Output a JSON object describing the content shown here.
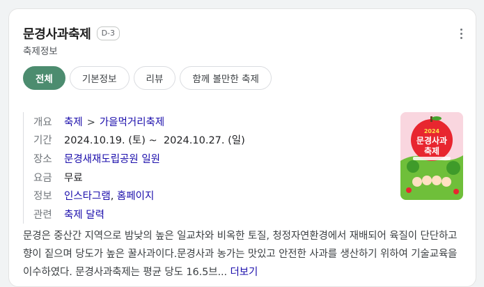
{
  "header": {
    "title": "문경사과축제",
    "dday_badge": "D-3",
    "subtitle": "축제정보"
  },
  "tabs": [
    {
      "label": "전체",
      "active": true
    },
    {
      "label": "기본정보",
      "active": false
    },
    {
      "label": "리뷰",
      "active": false
    },
    {
      "label": "함께 볼만한 축제",
      "active": false
    }
  ],
  "info": {
    "overview": {
      "key": "개요",
      "category": "축제",
      "separator": ">",
      "subcategory": "가을먹거리축제"
    },
    "period": {
      "key": "기간",
      "value": "2024.10.19. (토) ~  2024.10.27. (일)"
    },
    "place": {
      "key": "장소",
      "value": "문경새재도립공원 일원"
    },
    "fee": {
      "key": "요금",
      "value": "무료"
    },
    "links": {
      "key": "정보",
      "instagram": "인스타그램",
      "comma": ",",
      "homepage": "홈페이지"
    },
    "related": {
      "key": "관련",
      "value": "축제 달력"
    }
  },
  "poster": {
    "year": "2024",
    "title_line1": "문경사과",
    "title_line2": "축제",
    "icon": "apple-festival-poster"
  },
  "description": {
    "text": "문경은 중산간 지역으로 밤낮의 높은 일교차와 비옥한 토질, 청정자연환경에서 재배되어 육질이 단단하고 향이 짙으며 당도가 높은 꿀사과이다.문경사과 농가는 맛있고 안전한 사과를 생산하기 위하여 기술교육을 이수하였다. 문경사과축제는 평균 당도 16.5브... ",
    "more_label": "더보기"
  },
  "colors": {
    "accent": "#4c8c6f",
    "link": "#1a0dab"
  }
}
